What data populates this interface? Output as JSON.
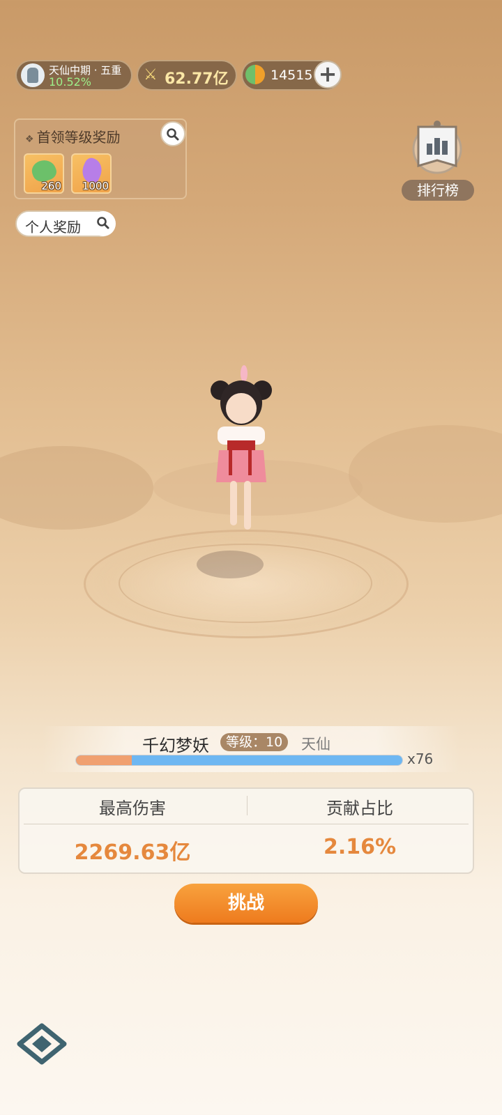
{
  "top_bar": {
    "realm_name": "天仙中期 · 五重",
    "realm_progress": "10.52%",
    "power_value": "62.77亿",
    "currency_value": "14515",
    "plus_label": "+"
  },
  "boss_reward": {
    "title": "首领等级奖励",
    "items": [
      {
        "icon": "green-dragon-icon",
        "count": "260"
      },
      {
        "icon": "purple-crystal-icon",
        "count": "1000"
      }
    ]
  },
  "personal_reward": {
    "label": "个人奖励"
  },
  "ranking": {
    "label": "排行榜"
  },
  "boss": {
    "name": "千幻梦妖",
    "level_label": "等级：10",
    "realm": "天仙",
    "hp_multiplier": "x76",
    "hp_remaining_fraction": 0.17
  },
  "stats": {
    "max_damage_label": "最高伤害",
    "max_damage_value": "2269.63亿",
    "contribution_label": "贡献占比",
    "contribution_value": "2.16%"
  },
  "challenge_button": {
    "label": "挑战"
  },
  "colors": {
    "accent_orange": "#ee7b1e",
    "stat_value": "#e5883d",
    "hp_blue": "#6eb7f2",
    "hp_orange": "#f0a070",
    "realm_progress_green": "#9ef08a"
  }
}
